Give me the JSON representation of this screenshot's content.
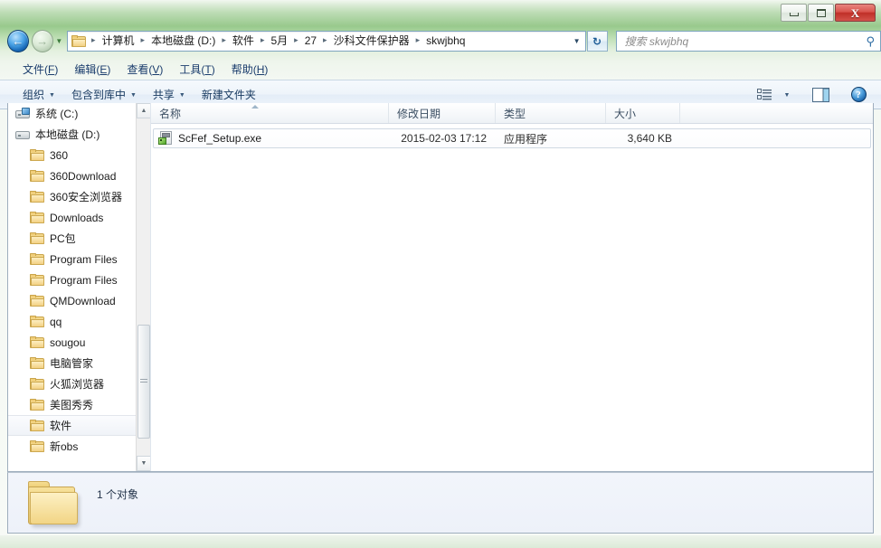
{
  "window": {
    "buttons": {
      "minimize": "–",
      "maximize": "□",
      "close": "X"
    }
  },
  "nav": {
    "back_icon": "←",
    "forward_icon": "→",
    "recent_caret": "▼",
    "address_caret": "▼",
    "refresh_icon": "↻",
    "breadcrumbs": [
      "计算机",
      "本地磁盘 (D:)",
      "软件",
      "5月",
      "27",
      "沙科文件保护器",
      "skwjbhq"
    ],
    "separator": "▸",
    "search": {
      "placeholder": "搜索 skwjbhq",
      "icon": "⚲"
    }
  },
  "menubar": {
    "items": [
      {
        "text": "文件",
        "key": "F"
      },
      {
        "text": "编辑",
        "key": "E"
      },
      {
        "text": "查看",
        "key": "V"
      },
      {
        "text": "工具",
        "key": "T"
      },
      {
        "text": "帮助",
        "key": "H"
      }
    ]
  },
  "toolbar": {
    "items": [
      {
        "label": "组织",
        "has_caret": true
      },
      {
        "label": "包含到库中",
        "has_caret": true
      },
      {
        "label": "共享",
        "has_caret": true
      },
      {
        "label": "新建文件夹",
        "has_caret": false
      }
    ],
    "caret": "▼",
    "view_caret": "▼",
    "help_label": "?"
  },
  "navpane": {
    "items": [
      {
        "label": "系统 (C:)",
        "icon": "system-drive-icon",
        "level": 0,
        "selected": false
      },
      {
        "label": "本地磁盘 (D:)",
        "icon": "drive-icon",
        "level": 0,
        "selected": false
      },
      {
        "label": "360",
        "icon": "folder-icon",
        "level": 1,
        "selected": false
      },
      {
        "label": "360Download",
        "icon": "folder-icon",
        "level": 1,
        "selected": false
      },
      {
        "label": "360安全浏览器",
        "icon": "folder-icon",
        "level": 1,
        "selected": false
      },
      {
        "label": "Downloads",
        "icon": "folder-icon",
        "level": 1,
        "selected": false
      },
      {
        "label": "PC包",
        "icon": "folder-icon",
        "level": 1,
        "selected": false
      },
      {
        "label": "Program Files",
        "icon": "folder-icon",
        "level": 1,
        "selected": false
      },
      {
        "label": "Program Files",
        "icon": "folder-icon",
        "level": 1,
        "selected": false
      },
      {
        "label": "QMDownload",
        "icon": "folder-icon",
        "level": 1,
        "selected": false
      },
      {
        "label": "qq",
        "icon": "folder-icon",
        "level": 1,
        "selected": false
      },
      {
        "label": "sougou",
        "icon": "folder-icon",
        "level": 1,
        "selected": false
      },
      {
        "label": "电脑管家",
        "icon": "folder-icon",
        "level": 1,
        "selected": false
      },
      {
        "label": "火狐浏览器",
        "icon": "folder-icon",
        "level": 1,
        "selected": false
      },
      {
        "label": "美图秀秀",
        "icon": "folder-icon",
        "level": 1,
        "selected": false
      },
      {
        "label": "软件",
        "icon": "folder-icon",
        "level": 1,
        "selected": true
      },
      {
        "label": "新obs",
        "icon": "folder-icon",
        "level": 1,
        "selected": false
      }
    ],
    "scroll_up": "▲",
    "scroll_down": "▼"
  },
  "filelist": {
    "columns": [
      {
        "key": "name",
        "label": "名称",
        "sorted": true
      },
      {
        "key": "date",
        "label": "修改日期",
        "sorted": false
      },
      {
        "key": "type",
        "label": "类型",
        "sorted": false
      },
      {
        "key": "size",
        "label": "大小",
        "sorted": false
      }
    ],
    "rows": [
      {
        "name": "ScFef_Setup.exe",
        "date": "2015-02-03 17:12",
        "type": "应用程序",
        "size": "3,640 KB",
        "icon": "exe-file-icon"
      }
    ]
  },
  "details": {
    "status_text": "1 个对象"
  },
  "colors": {
    "frame_green": "#98c98c",
    "close_red": "#c02f28",
    "back_blue": "#1667b5",
    "folder_yellow": "#f3d184",
    "accent_link": "#16385f"
  }
}
